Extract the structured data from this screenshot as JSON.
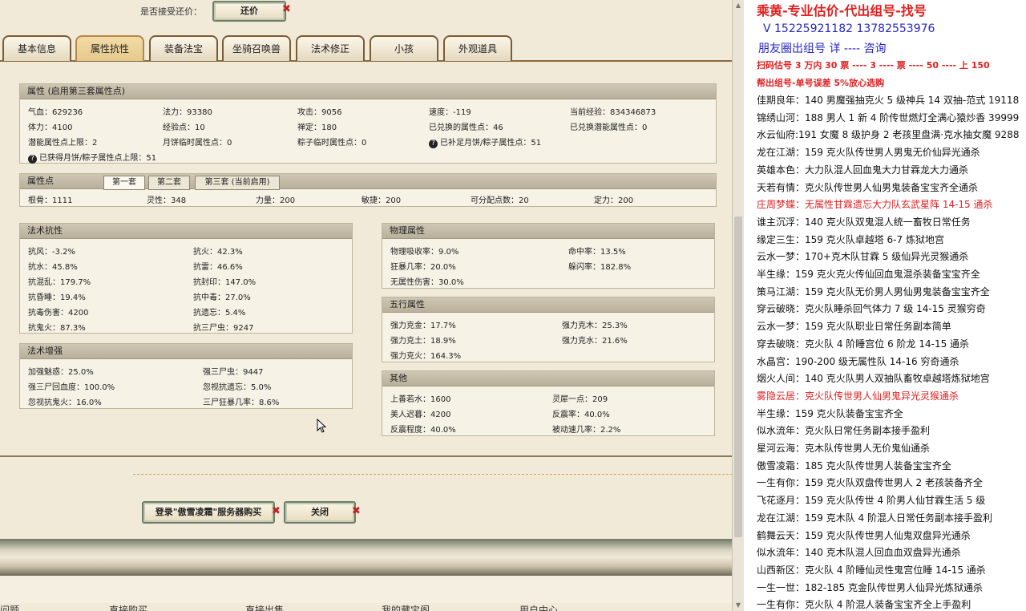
{
  "top": {
    "question": "是否接受还价：",
    "counter_button": "还价"
  },
  "tabs": [
    "基本信息",
    "属性抗性",
    "装备法宝",
    "坐骑召唤兽",
    "法术修正",
    "小孩",
    "外观道具"
  ],
  "attrs": {
    "title": "属性 (启用第三套属性点)",
    "rows": [
      [
        "气血：629236",
        "法力：93380",
        "攻击：9056",
        "速度：-119",
        "当前经验：834346873"
      ],
      [
        "体力：4100",
        "经验点：10",
        "禅定：180",
        "已兑换的属性点：46",
        "已兑换潜能属性点：0"
      ],
      [
        "潜能属性点上限：2",
        "月饼临时属性点：0",
        "粽子临时属性点：0",
        "已补足月饼/粽子属性点：51",
        ""
      ]
    ],
    "extra": "已获得月饼/粽子属性点上限：51"
  },
  "points": {
    "title": "属性点",
    "subtabs": [
      "第一套",
      "第二套",
      "第三套 (当前启用)"
    ],
    "row": [
      "根骨：1111",
      "灵性：348",
      "力量：200",
      "敏捷：200",
      "可分配点数：20",
      "定力：200"
    ]
  },
  "resist": {
    "title": "法术抗性",
    "left": [
      "抗风：-3.2%",
      "抗水：45.8%",
      "抗混乱：179.7%",
      "抗昏睡：19.4%",
      "抗毒伤害：4200",
      "抗鬼火：87.3%"
    ],
    "right": [
      "抗火：42.3%",
      "抗雷：46.6%",
      "抗封印：147.0%",
      "抗中毒：27.0%",
      "抗遗忘：5.4%",
      "抗三尸虫：9247"
    ]
  },
  "boost": {
    "title": "法术增强",
    "left": [
      "加强魅惑：25.0%",
      "强三尸回血度：100.0%",
      "忽视抗鬼火：16.0%"
    ],
    "right": [
      "强三尸虫：9447",
      "忽视抗遗忘：5.0%",
      "三尸狂暴几率：8.6%"
    ]
  },
  "physical": {
    "title": "物理属性",
    "left": [
      "物理吸收率：9.0%",
      "狂暴几率：20.0%",
      "无属性伤害：30.0%"
    ],
    "right": [
      "命中率：13.5%",
      "躲闪率：182.8%",
      ""
    ]
  },
  "elements": {
    "title": "五行属性",
    "left": [
      "强力克金：17.7%",
      "强力克土：18.9%",
      "强力克火：164.3%"
    ],
    "right": [
      "强力克木：25.3%",
      "强力克水：21.6%",
      ""
    ]
  },
  "other": {
    "title": "其他",
    "left": [
      "上善若水：1600",
      "美人迟暮：4200",
      "反震程度：40.0%"
    ],
    "right": [
      "灵犀一点：209",
      "反震率：40.0%",
      "被动速几率：2.2%"
    ]
  },
  "actions": {
    "buy": "登录\"傲雪凌霜\"服务器购买",
    "close": "关闭"
  },
  "bottom_nav": [
    "问题",
    "直接购买",
    "直接出售",
    "我的藏宝阁",
    "用户中心"
  ],
  "notes": {
    "title": "乘黄-专业估价-代出组号-找号",
    "phone": "V 15225921182   13782553976",
    "line3": "朋友圈出组号   详  ----  咨询",
    "promo1": "扫码估号 3 万内 30 票 ---- 3 ---- 票 ---- 50 ---- 上 150",
    "promo2": "帮出组号-单号误差 5%放心选购",
    "lines": [
      {
        "t": "佳期良年：140 男魔强抽克火 5 级神兵 14 双抽-范式 19118",
        "red": false
      },
      {
        "t": "锦绣山河：188 男人 1 新 4 阶传世燃灯全满心猿炒香 39999",
        "red": false
      },
      {
        "t": "水云仙府:191 女魔 8 级护身 2 老孩里盘满·克水抽女魔 9288",
        "red": false
      },
      {
        "t": "龙在江湖：159 克火队传世男人男鬼无价仙异光通杀",
        "red": false
      },
      {
        "t": "英雄本色：大力队混人回血鬼大力甘霖龙大力通杀",
        "red": false
      },
      {
        "t": "天若有情：克火队传世男人仙男鬼装备宝宝齐全通杀",
        "red": false
      },
      {
        "t": "庄周梦蝶：无属性甘霖遗忘大力队玄武星阵 14-15 通杀",
        "red": true
      },
      {
        "t": "谁主沉浮：140 克火队双鬼混人统一畜牧日常任务",
        "red": false
      },
      {
        "t": "缘定三生：159 克火队卓越塔 6-7 炼狱地宫",
        "red": false
      },
      {
        "t": "云水一梦：170+克木队甘霖 5 级仙异光灵猴通杀",
        "red": false
      },
      {
        "t": "半生缘：159 克火克火传仙回血鬼混杀装备宝宝齐全",
        "red": false
      },
      {
        "t": "策马江湖：159 克火队无价男人男仙男鬼装备宝宝齐全",
        "red": false
      },
      {
        "t": "穿云破晓：克火队睡杀回气体力 7 级 14-15 灵猴穷奇",
        "red": false
      },
      {
        "t": "云水一梦：159 克火队职业日常任务副本简单",
        "red": false
      },
      {
        "t": "穿去破晓：克火队 4 阶睡宫位 6 阶龙 14-15 通杀",
        "red": false
      },
      {
        "t": "水晶宫：190-200 级无属性队 14-16 穷奇通杀",
        "red": false
      },
      {
        "t": "烟火人间：140 克火队男人双抽队畜牧卓越塔炼狱地宫",
        "red": false
      },
      {
        "t": "雾隐云居：克火队传世男人仙男鬼异光灵猴通杀",
        "red": true
      },
      {
        "t": "半生缘：159 克火队装备宝宝齐全",
        "red": false
      },
      {
        "t": "似水流年：克火队日常任务副本接手盈利",
        "red": false
      },
      {
        "t": "星河云海：克木队传世男人无价鬼仙通杀",
        "red": false
      },
      {
        "t": "傲雪凌霜：185 克火队传世男人装备宝宝齐全",
        "red": false
      },
      {
        "t": "一生有你：159 克火队双盘传世男人 2 老孩装备齐全",
        "red": false
      },
      {
        "t": "飞花逐月：159 克火队传世 4 阶男人仙甘霖生活 5 级",
        "red": false
      },
      {
        "t": "龙在江湖：159 克木队 4 阶混人日常任务副本接手盈利",
        "red": false
      },
      {
        "t": "鹤舞云天：159 克火队传世男人仙鬼双盘异光通杀",
        "red": false
      },
      {
        "t": "似水流年：140 克木队混人回血血双盘异光通杀",
        "red": false
      },
      {
        "t": "山西新区：克火队 4 阶睡仙灵性鬼宫位睡 14-15 通杀",
        "red": false
      },
      {
        "t": "一生一世：182-185 克金队传世男人仙异光炼狱通杀",
        "red": false
      },
      {
        "t": "一生有你：克火队 4 阶混人装备宝宝齐全上手盈利",
        "red": false
      }
    ]
  },
  "colors": {
    "red_text": "#e02020",
    "blue_text": "#2525c8",
    "title_red": "#e02020"
  }
}
